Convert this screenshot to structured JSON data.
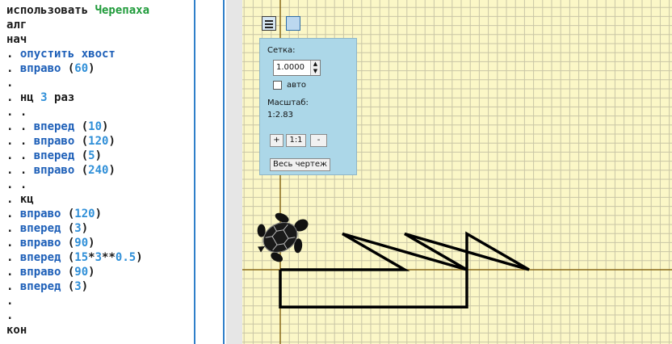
{
  "editor": {
    "lines": [
      [
        {
          "t": "использовать ",
          "c": "kw"
        },
        {
          "t": "Черепаха",
          "c": "lib"
        }
      ],
      [
        {
          "t": "алг",
          "c": "kw"
        }
      ],
      [
        {
          "t": "нач",
          "c": "kw"
        }
      ],
      [
        {
          "t": ". ",
          "c": "dot"
        },
        {
          "t": "опустить хвост",
          "c": "cmd"
        }
      ],
      [
        {
          "t": ". ",
          "c": "dot"
        },
        {
          "t": "вправо",
          "c": "cmd"
        },
        {
          "t": " (",
          "c": "kw"
        },
        {
          "t": "60",
          "c": "num"
        },
        {
          "t": ")",
          "c": "kw"
        }
      ],
      [
        {
          "t": ".",
          "c": "dot"
        }
      ],
      [
        {
          "t": ". ",
          "c": "dot"
        },
        {
          "t": "нц ",
          "c": "kw"
        },
        {
          "t": "3",
          "c": "num"
        },
        {
          "t": " раз",
          "c": "kw"
        }
      ],
      [
        {
          "t": ". .",
          "c": "dot"
        }
      ],
      [
        {
          "t": ". . ",
          "c": "dot"
        },
        {
          "t": "вперед",
          "c": "cmd"
        },
        {
          "t": " (",
          "c": "kw"
        },
        {
          "t": "10",
          "c": "num"
        },
        {
          "t": ")",
          "c": "kw"
        }
      ],
      [
        {
          "t": ". . ",
          "c": "dot"
        },
        {
          "t": "вправо",
          "c": "cmd"
        },
        {
          "t": " (",
          "c": "kw"
        },
        {
          "t": "120",
          "c": "num"
        },
        {
          "t": ")",
          "c": "kw"
        }
      ],
      [
        {
          "t": ". . ",
          "c": "dot"
        },
        {
          "t": "вперед",
          "c": "cmd"
        },
        {
          "t": " (",
          "c": "kw"
        },
        {
          "t": "5",
          "c": "num"
        },
        {
          "t": ")",
          "c": "kw"
        }
      ],
      [
        {
          "t": ". . ",
          "c": "dot"
        },
        {
          "t": "вправо",
          "c": "cmd"
        },
        {
          "t": " (",
          "c": "kw"
        },
        {
          "t": "240",
          "c": "num"
        },
        {
          "t": ")",
          "c": "kw"
        }
      ],
      [
        {
          "t": ". .",
          "c": "dot"
        }
      ],
      [
        {
          "t": ". ",
          "c": "dot"
        },
        {
          "t": "кц",
          "c": "kw"
        }
      ],
      [
        {
          "t": ". ",
          "c": "dot"
        },
        {
          "t": "вправо",
          "c": "cmd"
        },
        {
          "t": " (",
          "c": "kw"
        },
        {
          "t": "120",
          "c": "num"
        },
        {
          "t": ")",
          "c": "kw"
        }
      ],
      [
        {
          "t": ". ",
          "c": "dot"
        },
        {
          "t": "вперед",
          "c": "cmd"
        },
        {
          "t": " (",
          "c": "kw"
        },
        {
          "t": "3",
          "c": "num"
        },
        {
          "t": ")",
          "c": "kw"
        }
      ],
      [
        {
          "t": ". ",
          "c": "dot"
        },
        {
          "t": "вправо",
          "c": "cmd"
        },
        {
          "t": " (",
          "c": "kw"
        },
        {
          "t": "90",
          "c": "num"
        },
        {
          "t": ")",
          "c": "kw"
        }
      ],
      [
        {
          "t": ". ",
          "c": "dot"
        },
        {
          "t": "вперед",
          "c": "cmd"
        },
        {
          "t": " (",
          "c": "kw"
        },
        {
          "t": "15",
          "c": "num"
        },
        {
          "t": "*",
          "c": "kw"
        },
        {
          "t": "3",
          "c": "num"
        },
        {
          "t": "**",
          "c": "kw"
        },
        {
          "t": "0.5",
          "c": "num"
        },
        {
          "t": ")",
          "c": "kw"
        }
      ],
      [
        {
          "t": ". ",
          "c": "dot"
        },
        {
          "t": "вправо",
          "c": "cmd"
        },
        {
          "t": " (",
          "c": "kw"
        },
        {
          "t": "90",
          "c": "num"
        },
        {
          "t": ")",
          "c": "kw"
        }
      ],
      [
        {
          "t": ". ",
          "c": "dot"
        },
        {
          "t": "вперед",
          "c": "cmd"
        },
        {
          "t": " (",
          "c": "kw"
        },
        {
          "t": "3",
          "c": "num"
        },
        {
          "t": ")",
          "c": "kw"
        }
      ],
      [
        {
          "t": ".",
          "c": "dot"
        }
      ],
      [
        {
          "t": ".",
          "c": "dot"
        }
      ],
      [
        {
          "t": "кон",
          "c": "kw"
        }
      ]
    ]
  },
  "panel": {
    "grid_label": "Сетка:",
    "grid_value": "1.0000",
    "spin_up": "▲",
    "spin_down": "▼",
    "auto_label": "авто",
    "auto_checked": false,
    "scale_label": "Масштаб:",
    "scale_value": "1:2.83",
    "zoom_in": "+",
    "zoom_reset": "1:1",
    "zoom_out": "-",
    "fit_all": "Весь чертеж"
  },
  "turtle": {
    "heading_degrees": 60,
    "drawing": [
      [
        0,
        0
      ],
      [
        10,
        0
      ],
      [
        5,
        2.887
      ],
      [
        15,
        0
      ],
      [
        10,
        2.887
      ],
      [
        20,
        0
      ],
      [
        15,
        2.887
      ],
      [
        15,
        -3
      ],
      [
        0,
        -3
      ],
      [
        0,
        0
      ]
    ]
  },
  "colors": {
    "canvas_bg": "#fbf7c7",
    "grid": "#c9c6a6",
    "axis": "#8a6a1a",
    "drawing": "#000000",
    "accent": "#2f7fc9"
  }
}
